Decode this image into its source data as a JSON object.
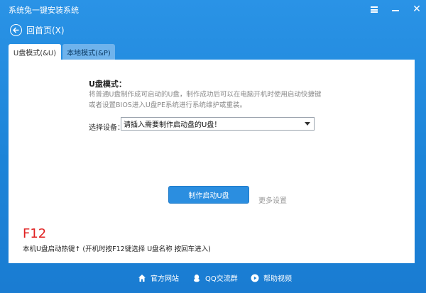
{
  "window": {
    "title": "系统兔一键安装系统",
    "buttons": {
      "menu_icon": "menu-icon",
      "minimize_icon": "minimize-icon",
      "close_icon": "close-icon",
      "close_glyph": "✕"
    }
  },
  "nav": {
    "back_label": "回首页(X)",
    "back_icon": "back-arrow-icon"
  },
  "tabs": [
    {
      "label": "U盘模式(&U)",
      "active": true
    },
    {
      "label": "本地模式(&P)",
      "active": false
    }
  ],
  "usb_mode": {
    "heading": "U盘模式：",
    "description": "将普通U盘制作成可启动的U盘，制作成功后可以在电脑开机时使用启动快捷键或者设置BIOS进入U盘PE系统进行系统维护或重装。",
    "device_label": "选择设备：",
    "device_value": "请插入需要制作启动盘的U盘！",
    "make_button": "制作启动U盘",
    "more_settings": "更多设置",
    "hotkey": "F12",
    "hotkey_note": "本机U盘启动热键↑ (开机时按F12键选择 U盘名称 按回车进入)"
  },
  "footer": {
    "links": [
      {
        "label": "官方网站",
        "icon": "home-icon"
      },
      {
        "label": "QQ交流群",
        "icon": "qq-icon"
      },
      {
        "label": "帮助视频",
        "icon": "play-icon"
      }
    ]
  },
  "colors": {
    "window_bg": "#1c84d8",
    "accent_button": "#2b8ee0",
    "inactive_tab": "#6fb3ec",
    "hotkey_red": "#e02020"
  }
}
